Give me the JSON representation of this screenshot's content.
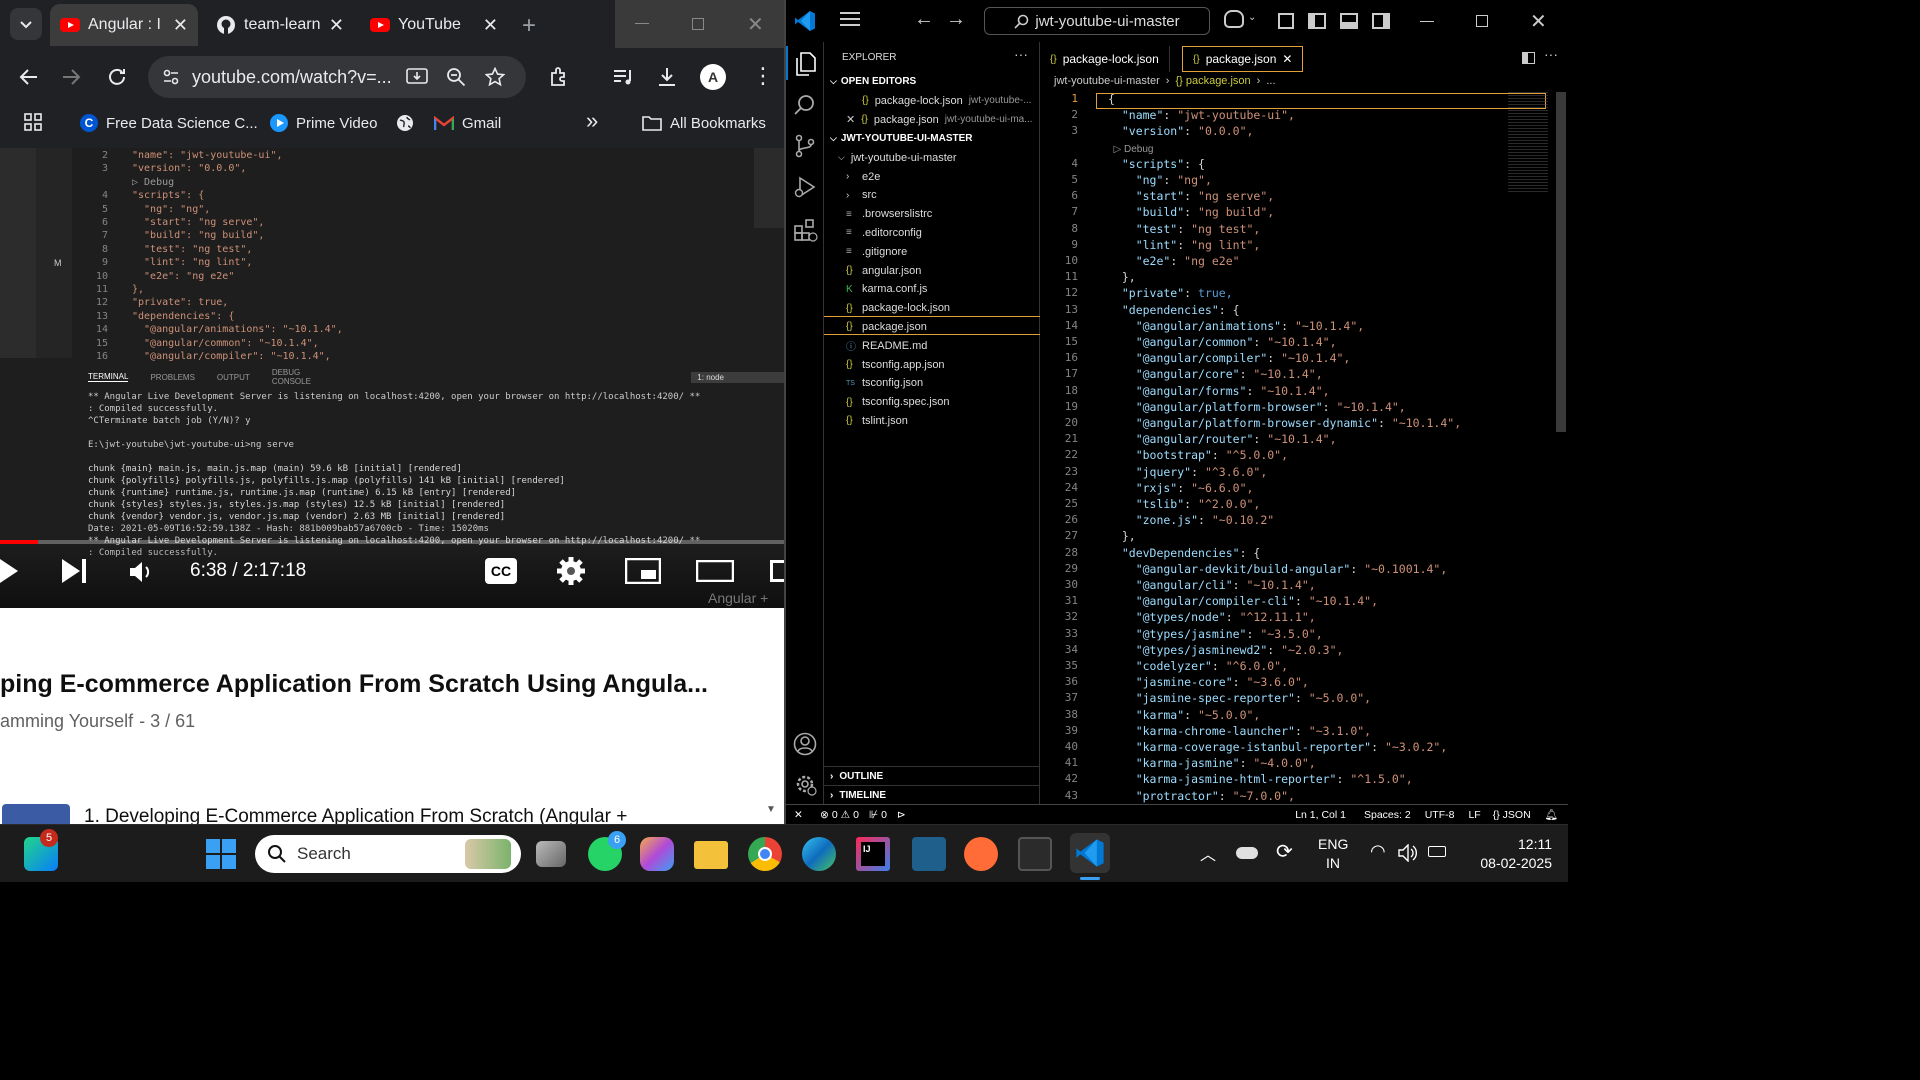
{
  "chrome": {
    "tabs": [
      {
        "label": "Angular : I",
        "icon": "youtube-icon"
      },
      {
        "label": "team-learn",
        "icon": "github-icon"
      },
      {
        "label": "YouTube",
        "icon": "youtube-icon"
      }
    ],
    "new_tab": "+",
    "url": "youtube.com/watch?v=...",
    "bookmarks": [
      {
        "label": "Free Data Science C...",
        "icon": "coursera-icon"
      },
      {
        "label": "Prime Video",
        "icon": "prime-video-icon"
      },
      {
        "label": "",
        "icon": "globe-icon"
      },
      {
        "label": "Gmail",
        "icon": "gmail-icon"
      }
    ],
    "more_bookmarks": "»",
    "all_bookmarks": "All Bookmarks"
  },
  "video": {
    "code_lines": [
      {
        "n": "2",
        "t": "\"name\": \"jwt-youtube-ui\","
      },
      {
        "n": "3",
        "t": "\"version\": \"0.0.0\","
      },
      {
        "n": "",
        "t": "▷ Debug"
      },
      {
        "n": "4",
        "t": "\"scripts\": {"
      },
      {
        "n": "5",
        "t": "  \"ng\": \"ng\","
      },
      {
        "n": "6",
        "t": "  \"start\": \"ng serve\","
      },
      {
        "n": "7",
        "t": "  \"build\": \"ng build\","
      },
      {
        "n": "8",
        "t": "  \"test\": \"ng test\","
      },
      {
        "n": "9",
        "t": "  \"lint\": \"ng lint\","
      },
      {
        "n": "10",
        "t": "  \"e2e\": \"ng e2e\""
      },
      {
        "n": "11",
        "t": "},"
      },
      {
        "n": "12",
        "t": "\"private\": true,"
      },
      {
        "n": "13",
        "t": "\"dependencies\": {"
      },
      {
        "n": "14",
        "t": "  \"@angular/animations\": \"~10.1.4\","
      },
      {
        "n": "15",
        "t": "  \"@angular/common\": \"~10.1.4\","
      },
      {
        "n": "16",
        "t": "  \"@angular/compiler\": \"~10.1.4\","
      }
    ],
    "panel_tabs": [
      "TERMINAL",
      "PROBLEMS",
      "OUTPUT",
      "DEBUG CONSOLE"
    ],
    "terminal_select": "1: node",
    "terminal_lines": [
      "** Angular Live Development Server is listening on localhost:4200, open your browser on http://localhost:4200/ **",
      ": Compiled successfully.",
      "^CTerminate batch job (Y/N)? y",
      "",
      "E:\\jwt-youtube\\jwt-youtube-ui>ng serve",
      "",
      "chunk {main} main.js, main.js.map (main) 59.6 kB [initial] [rendered]",
      "chunk {polyfills} polyfills.js, polyfills.js.map (polyfills) 141 kB [initial] [rendered]",
      "chunk {runtime} runtime.js, runtime.js.map (runtime) 6.15 kB [entry] [rendered]",
      "chunk {styles} styles.js, styles.js.map (styles) 12.5 kB [initial] [rendered]",
      "chunk {vendor} vendor.js, vendor.js.map (vendor) 2.63 MB [initial] [rendered]",
      "Date: 2021-05-09T16:52:59.138Z - Hash: 881b009bab57a6700cb - Time: 15020ms",
      "** Angular Live Development Server is listening on localhost:4200, open your browser on http://localhost:4200/ **",
      ": Compiled successfully."
    ],
    "time": "6:38 / 2:17:18",
    "progress": 0.048,
    "overlay_tag": "Angular +"
  },
  "youtube": {
    "title": "ping E-commerce Application From Scratch Using Angula...",
    "playlist": "amming Yourself",
    "playlist_pos": "- 3 / 61",
    "next_item": "1. Developing E-Commerce Application From Scratch (Angular +"
  },
  "vscode": {
    "search": "jwt-youtube-ui-master",
    "explorer_title": "EXPLORER",
    "open_editors_title": "OPEN EDITORS",
    "open_editors": [
      {
        "name": "package-lock.json",
        "path": "jwt-youtube-..."
      },
      {
        "name": "package.json",
        "path": "jwt-youtube-ui-ma..."
      }
    ],
    "project_title": "JWT-YOUTUBE-UI-MASTER",
    "root_folder": "jwt-youtube-ui-master",
    "tree": [
      {
        "name": "e2e",
        "kind": "folder"
      },
      {
        "name": "src",
        "kind": "folder"
      },
      {
        "name": ".browserslistrc",
        "kind": "file"
      },
      {
        "name": ".editorconfig",
        "kind": "file"
      },
      {
        "name": ".gitignore",
        "kind": "file"
      },
      {
        "name": "angular.json",
        "kind": "json"
      },
      {
        "name": "karma.conf.js",
        "kind": "karma"
      },
      {
        "name": "package-lock.json",
        "kind": "json"
      },
      {
        "name": "package.json",
        "kind": "json"
      },
      {
        "name": "README.md",
        "kind": "info"
      },
      {
        "name": "tsconfig.app.json",
        "kind": "json"
      },
      {
        "name": "tsconfig.json",
        "kind": "ts"
      },
      {
        "name": "tsconfig.spec.json",
        "kind": "json"
      },
      {
        "name": "tslint.json",
        "kind": "json"
      }
    ],
    "outline": "OUTLINE",
    "timeline": "TIMELINE",
    "editor_tabs": [
      {
        "label": "package-lock.json",
        "active": false
      },
      {
        "label": "package.json",
        "active": true
      }
    ],
    "breadcrumb": [
      "jwt-youtube-ui-master",
      "{} package.json",
      "..."
    ],
    "lines": [
      {
        "n": "1",
        "k": "",
        "v": "{",
        "kind": "p"
      },
      {
        "n": "2",
        "k": "  \"name\"",
        "v": "\"jwt-youtube-ui\",",
        "kind": "s"
      },
      {
        "n": "3",
        "k": "  \"version\"",
        "v": "\"0.0.0\",",
        "kind": "s"
      },
      {
        "n": "",
        "k": "",
        "v": "  ▷ Debug",
        "kind": "debug"
      },
      {
        "n": "4",
        "k": "  \"scripts\"",
        "v": "{",
        "kind": "p"
      },
      {
        "n": "5",
        "k": "    \"ng\"",
        "v": "\"ng\",",
        "kind": "s"
      },
      {
        "n": "6",
        "k": "    \"start\"",
        "v": "\"ng serve\",",
        "kind": "s"
      },
      {
        "n": "7",
        "k": "    \"build\"",
        "v": "\"ng build\",",
        "kind": "s"
      },
      {
        "n": "8",
        "k": "    \"test\"",
        "v": "\"ng test\",",
        "kind": "s"
      },
      {
        "n": "9",
        "k": "    \"lint\"",
        "v": "\"ng lint\",",
        "kind": "s"
      },
      {
        "n": "10",
        "k": "    \"e2e\"",
        "v": "\"ng e2e\"",
        "kind": "s"
      },
      {
        "n": "11",
        "k": "",
        "v": "  },",
        "kind": "p"
      },
      {
        "n": "12",
        "k": "  \"private\"",
        "v": "true,",
        "kind": "b"
      },
      {
        "n": "13",
        "k": "  \"dependencies\"",
        "v": "{",
        "kind": "p"
      },
      {
        "n": "14",
        "k": "    \"@angular/animations\"",
        "v": "\"~10.1.4\",",
        "kind": "s"
      },
      {
        "n": "15",
        "k": "    \"@angular/common\"",
        "v": "\"~10.1.4\",",
        "kind": "s"
      },
      {
        "n": "16",
        "k": "    \"@angular/compiler\"",
        "v": "\"~10.1.4\",",
        "kind": "s"
      },
      {
        "n": "17",
        "k": "    \"@angular/core\"",
        "v": "\"~10.1.4\",",
        "kind": "s"
      },
      {
        "n": "18",
        "k": "    \"@angular/forms\"",
        "v": "\"~10.1.4\",",
        "kind": "s"
      },
      {
        "n": "19",
        "k": "    \"@angular/platform-browser\"",
        "v": "\"~10.1.4\",",
        "kind": "s"
      },
      {
        "n": "20",
        "k": "    \"@angular/platform-browser-dynamic\"",
        "v": "\"~10.1.4\",",
        "kind": "s"
      },
      {
        "n": "21",
        "k": "    \"@angular/router\"",
        "v": "\"~10.1.4\",",
        "kind": "s"
      },
      {
        "n": "22",
        "k": "    \"bootstrap\"",
        "v": "\"^5.0.0\",",
        "kind": "s"
      },
      {
        "n": "23",
        "k": "    \"jquery\"",
        "v": "\"^3.6.0\",",
        "kind": "s"
      },
      {
        "n": "24",
        "k": "    \"rxjs\"",
        "v": "\"~6.6.0\",",
        "kind": "s"
      },
      {
        "n": "25",
        "k": "    \"tslib\"",
        "v": "\"^2.0.0\",",
        "kind": "s"
      },
      {
        "n": "26",
        "k": "    \"zone.js\"",
        "v": "\"~0.10.2\"",
        "kind": "s"
      },
      {
        "n": "27",
        "k": "",
        "v": "  },",
        "kind": "p"
      },
      {
        "n": "28",
        "k": "  \"devDependencies\"",
        "v": "{",
        "kind": "p"
      },
      {
        "n": "29",
        "k": "    \"@angular-devkit/build-angular\"",
        "v": "\"~0.1001.4\",",
        "kind": "s"
      },
      {
        "n": "30",
        "k": "    \"@angular/cli\"",
        "v": "\"~10.1.4\",",
        "kind": "s"
      },
      {
        "n": "31",
        "k": "    \"@angular/compiler-cli\"",
        "v": "\"~10.1.4\",",
        "kind": "s"
      },
      {
        "n": "32",
        "k": "    \"@types/node\"",
        "v": "\"^12.11.1\",",
        "kind": "s"
      },
      {
        "n": "33",
        "k": "    \"@types/jasmine\"",
        "v": "\"~3.5.0\",",
        "kind": "s"
      },
      {
        "n": "34",
        "k": "    \"@types/jasminewd2\"",
        "v": "\"~2.0.3\",",
        "kind": "s"
      },
      {
        "n": "35",
        "k": "    \"codelyzer\"",
        "v": "\"^6.0.0\",",
        "kind": "s"
      },
      {
        "n": "36",
        "k": "    \"jasmine-core\"",
        "v": "\"~3.6.0\",",
        "kind": "s"
      },
      {
        "n": "37",
        "k": "    \"jasmine-spec-reporter\"",
        "v": "\"~5.0.0\",",
        "kind": "s"
      },
      {
        "n": "38",
        "k": "    \"karma\"",
        "v": "\"~5.0.0\",",
        "kind": "s"
      },
      {
        "n": "39",
        "k": "    \"karma-chrome-launcher\"",
        "v": "\"~3.1.0\",",
        "kind": "s"
      },
      {
        "n": "40",
        "k": "    \"karma-coverage-istanbul-reporter\"",
        "v": "\"~3.0.2\",",
        "kind": "s"
      },
      {
        "n": "41",
        "k": "    \"karma-jasmine\"",
        "v": "\"~4.0.0\",",
        "kind": "s"
      },
      {
        "n": "42",
        "k": "    \"karma-jasmine-html-reporter\"",
        "v": "\"^1.5.0\",",
        "kind": "s"
      },
      {
        "n": "43",
        "k": "    \"protractor\"",
        "v": "\"~7.0.0\",",
        "kind": "s"
      }
    ],
    "status": {
      "errors": "0",
      "warnings": "0",
      "ports": "0",
      "position": "Ln 1, Col 1",
      "spaces": "Spaces: 2",
      "encoding": "UTF-8",
      "eol": "LF",
      "language": "{} JSON"
    }
  },
  "taskbar": {
    "search": "Search",
    "badge_pycharm": "5",
    "badge_whatsapp": "6",
    "lang": "ENG",
    "region": "IN",
    "time": "12:11",
    "date": "08-02-2025"
  },
  "colors": {
    "youtube_red": "#ff0000",
    "vscode_accent": "#0078d4",
    "active_tab_border": "#e2a03a"
  }
}
